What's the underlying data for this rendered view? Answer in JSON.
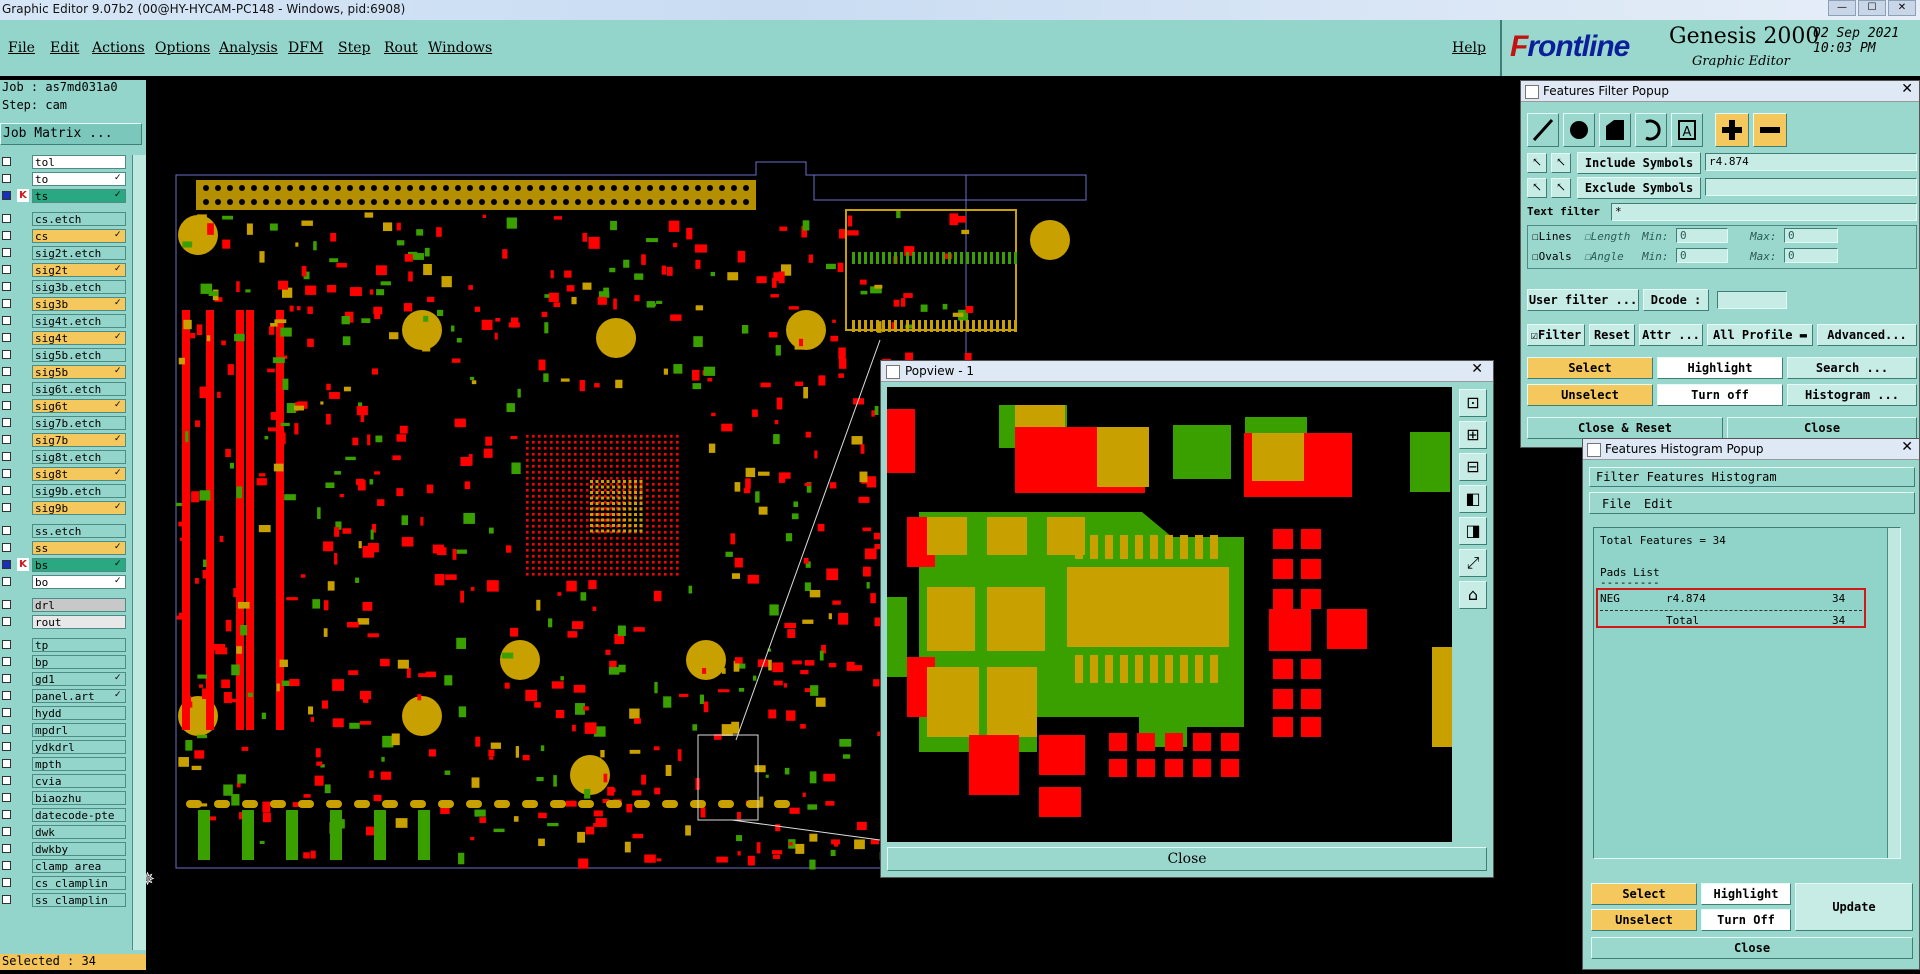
{
  "window": {
    "title": "Graphic Editor 9.07b2 (00@HY-HYCAM-PC148 - Windows, pid:6908)",
    "controls": [
      "—",
      "☐",
      "✕"
    ]
  },
  "menu": {
    "items": [
      "File",
      "Edit",
      "Actions",
      "Options",
      "Analysis",
      "DFM",
      "Step",
      "Rout",
      "Windows"
    ],
    "help": "Help"
  },
  "brand": {
    "logo_f": "F",
    "logo_rest": "rontline",
    "product": "Genesis 2000",
    "subtitle": "Graphic Editor",
    "date": "02 Sep 2021",
    "time": "10:03 PM"
  },
  "left_panel": {
    "job": "Job : as7md031a0",
    "step": "Step: cam",
    "job_matrix": "Job Matrix ...",
    "selected": "Selected : 34",
    "layers": [
      {
        "name": "tol",
        "color": "#ffffff",
        "checked": false,
        "mark": ""
      },
      {
        "name": "to",
        "color": "#ffffff",
        "checked": false,
        "mark": "✓"
      },
      {
        "name": "ts",
        "color": "#2aa882",
        "checked": true,
        "mark": "✓",
        "icon": "K"
      },
      {
        "name": "cs.etch",
        "color": "#93d5cb",
        "checked": false,
        "mark": ""
      },
      {
        "name": "cs",
        "color": "#f5c85e",
        "checked": false,
        "mark": "✓"
      },
      {
        "name": "sig2t.etch",
        "color": "#93d5cb",
        "checked": false,
        "mark": ""
      },
      {
        "name": "sig2t",
        "color": "#f5c85e",
        "checked": false,
        "mark": "✓"
      },
      {
        "name": "sig3b.etch",
        "color": "#93d5cb",
        "checked": false,
        "mark": ""
      },
      {
        "name": "sig3b",
        "color": "#f5c85e",
        "checked": false,
        "mark": "✓"
      },
      {
        "name": "sig4t.etch",
        "color": "#93d5cb",
        "checked": false,
        "mark": ""
      },
      {
        "name": "sig4t",
        "color": "#f5c85e",
        "checked": false,
        "mark": "✓"
      },
      {
        "name": "sig5b.etch",
        "color": "#93d5cb",
        "checked": false,
        "mark": ""
      },
      {
        "name": "sig5b",
        "color": "#f5c85e",
        "checked": false,
        "mark": "✓"
      },
      {
        "name": "sig6t.etch",
        "color": "#93d5cb",
        "checked": false,
        "mark": ""
      },
      {
        "name": "sig6t",
        "color": "#f5c85e",
        "checked": false,
        "mark": "✓"
      },
      {
        "name": "sig7b.etch",
        "color": "#93d5cb",
        "checked": false,
        "mark": ""
      },
      {
        "name": "sig7b",
        "color": "#f5c85e",
        "checked": false,
        "mark": "✓"
      },
      {
        "name": "sig8t.etch",
        "color": "#93d5cb",
        "checked": false,
        "mark": ""
      },
      {
        "name": "sig8t",
        "color": "#f5c85e",
        "checked": false,
        "mark": "✓"
      },
      {
        "name": "sig9b.etch",
        "color": "#93d5cb",
        "checked": false,
        "mark": ""
      },
      {
        "name": "sig9b",
        "color": "#f5c85e",
        "checked": false,
        "mark": "✓"
      },
      {
        "name": "ss.etch",
        "color": "#93d5cb",
        "checked": false,
        "mark": ""
      },
      {
        "name": "ss",
        "color": "#f5c85e",
        "checked": false,
        "mark": "✓"
      },
      {
        "name": "bs",
        "color": "#2aa882",
        "checked": true,
        "mark": "✓",
        "icon": "K"
      },
      {
        "name": "bo",
        "color": "#ffffff",
        "checked": false,
        "mark": "✓"
      },
      {
        "name": "drl",
        "color": "#c8c8c8",
        "checked": false,
        "mark": ""
      },
      {
        "name": "rout",
        "color": "#e8e8e8",
        "checked": false,
        "mark": ""
      },
      {
        "name": "tp",
        "color": "#93d5cb",
        "checked": false,
        "mark": ""
      },
      {
        "name": "bp",
        "color": "#93d5cb",
        "checked": false,
        "mark": ""
      },
      {
        "name": "gd1",
        "color": "#93d5cb",
        "checked": false,
        "mark": "✓"
      },
      {
        "name": "panel.art",
        "color": "#93d5cb",
        "checked": false,
        "mark": "✓"
      },
      {
        "name": "hydd",
        "color": "#93d5cb",
        "checked": false,
        "mark": ""
      },
      {
        "name": "mpdrl",
        "color": "#93d5cb",
        "checked": false,
        "mark": ""
      },
      {
        "name": "ydkdrl",
        "color": "#93d5cb",
        "checked": false,
        "mark": ""
      },
      {
        "name": "mpth",
        "color": "#93d5cb",
        "checked": false,
        "mark": ""
      },
      {
        "name": "cvia",
        "color": "#93d5cb",
        "checked": false,
        "mark": ""
      },
      {
        "name": "biaozhu",
        "color": "#93d5cb",
        "checked": false,
        "mark": ""
      },
      {
        "name": "datecode-pte",
        "color": "#93d5cb",
        "checked": false,
        "mark": ""
      },
      {
        "name": "dwk",
        "color": "#93d5cb",
        "checked": false,
        "mark": ""
      },
      {
        "name": "dwkby",
        "color": "#93d5cb",
        "checked": false,
        "mark": ""
      },
      {
        "name": "clamp_area",
        "color": "#93d5cb",
        "checked": false,
        "mark": ""
      },
      {
        "name": "cs_clamplin",
        "color": "#93d5cb",
        "checked": false,
        "mark": ""
      },
      {
        "name": "ss_clamplin",
        "color": "#93d5cb",
        "checked": false,
        "mark": ""
      }
    ]
  },
  "popview": {
    "title": "Popview - 1",
    "close": "Close",
    "tools": [
      "zoom-window-icon",
      "zoom-in-icon",
      "zoom-out-icon",
      "pan-left-icon",
      "pan-right-icon",
      "fit-icon",
      "home-icon"
    ]
  },
  "filter_popup": {
    "title": "Features Filter Popup",
    "include_label": "Include Symbols :",
    "include_value": "r4.874",
    "exclude_label": "Exclude Symbols :",
    "exclude_value": "",
    "text_filter_label": "Text filter",
    "text_filter_value": "*",
    "lines": "Lines",
    "ovals": "Ovals",
    "length": "Length",
    "angle": "Angle",
    "min": "Min:",
    "max": "Max:",
    "zero": "0",
    "user_filter": "User filter ...",
    "dcode": "Dcode :",
    "filter": "Filter",
    "reset": "Reset",
    "attr": "Attr ...",
    "all_profile": "All Profile",
    "advanced": "Advanced...",
    "select": "Select",
    "highlight": "Highlight",
    "search": "Search ...",
    "unselect": "Unselect",
    "turn_off": "Turn off",
    "histogram": "Histogram ...",
    "close_reset": "Close & Reset",
    "close": "Close"
  },
  "histogram_popup": {
    "title": "Features Histogram Popup",
    "heading": "Filter Features Histogram",
    "menu_file": "File",
    "menu_edit": "Edit",
    "total_features": "Total Features = 34",
    "pads_list": "Pads List",
    "underline": "---------",
    "row": {
      "polarity": "NEG",
      "symbol": "r4.874",
      "count": "34"
    },
    "total_label": "Total",
    "total_count": "34",
    "select": "Select",
    "highlight": "Highlight",
    "update": "Update",
    "unselect": "Unselect",
    "turn_off": "Turn Off",
    "close": "Close"
  },
  "colors": {
    "panel": "#93d5cb",
    "select_yellow": "#f5c85e",
    "pad_red": "#ff0000",
    "pad_green": "#3aa000",
    "pad_gold": "#c8a000"
  }
}
